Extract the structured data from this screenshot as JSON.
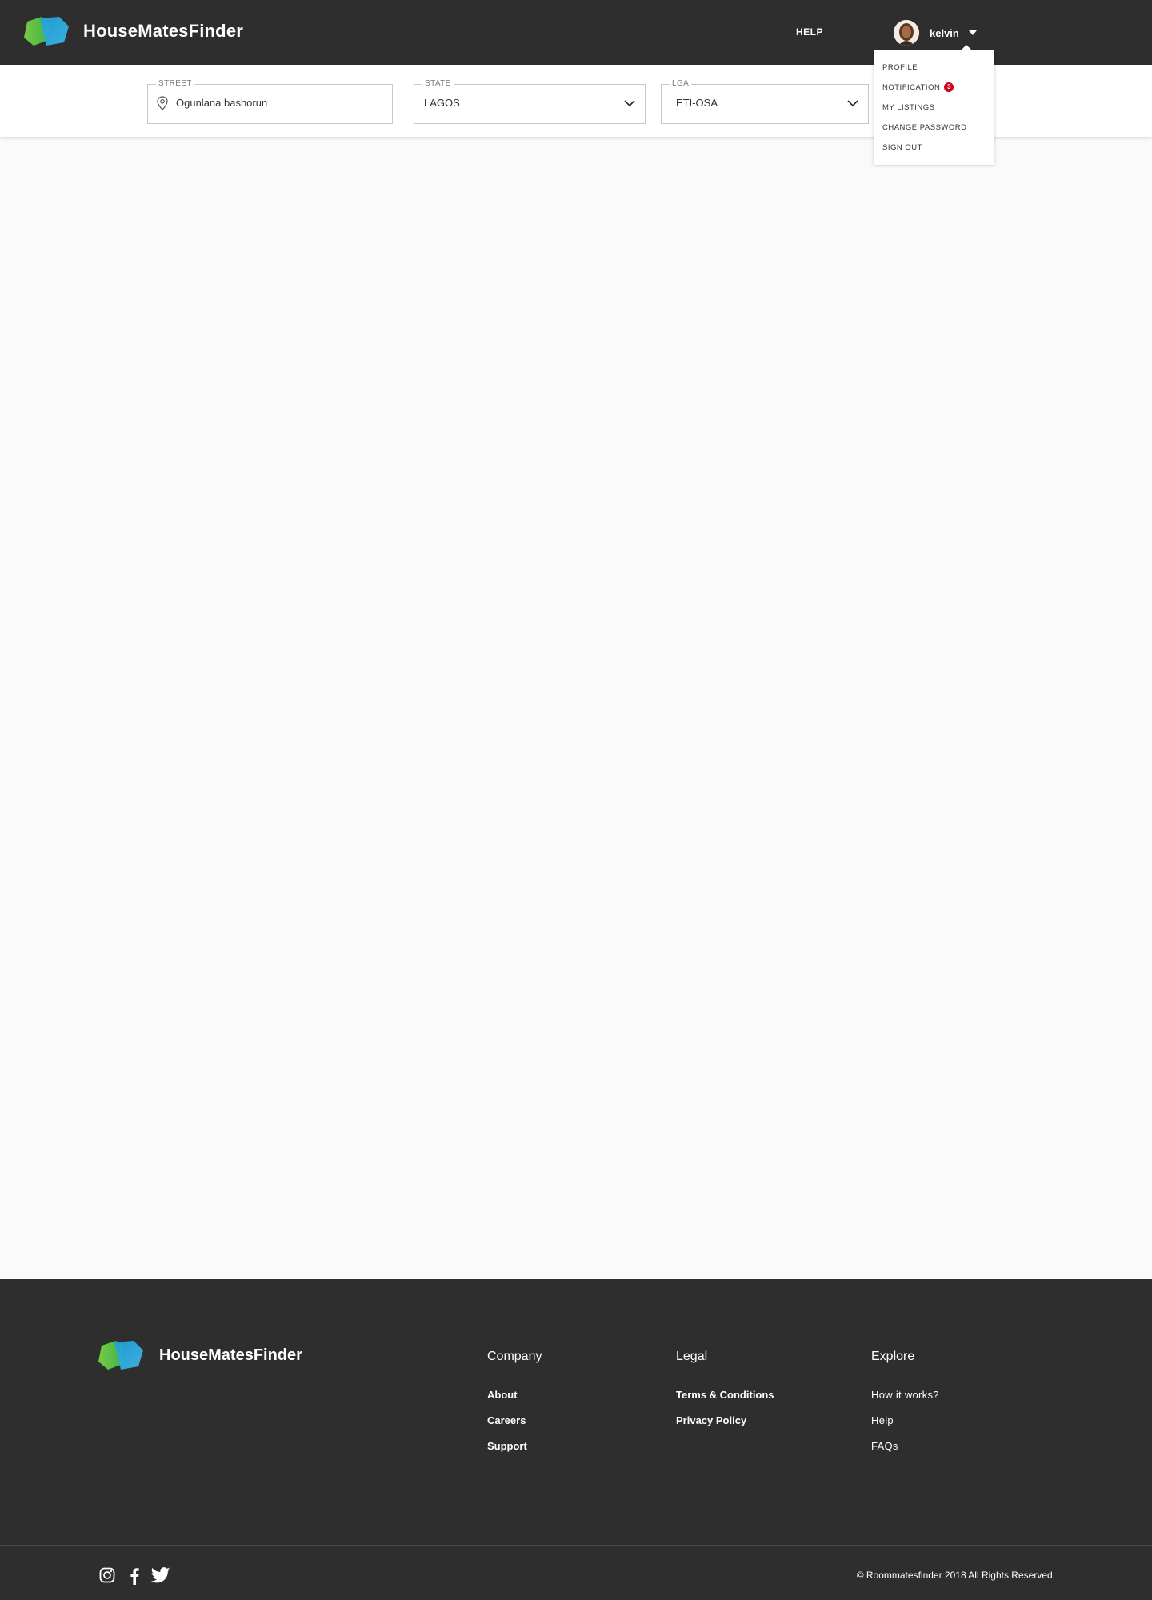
{
  "header": {
    "brand": "HouseMatesFinder",
    "help_label": "HELP",
    "user_name": "kelvin"
  },
  "user_dropdown": {
    "items": [
      {
        "label": "PROFILE"
      },
      {
        "label": "NOTIFICATION",
        "badge": "3"
      },
      {
        "label": "MY LISTINGS"
      },
      {
        "label": "CHANGE PASSWORD"
      },
      {
        "label": "SIGN OUT"
      }
    ]
  },
  "search": {
    "street": {
      "label": "STREET",
      "value": "Ogunlana bashorun"
    },
    "state": {
      "label": "STATE",
      "value": "LAGOS"
    },
    "lga": {
      "label": "LGA",
      "value": "ETI-OSA"
    }
  },
  "footer": {
    "brand": "HouseMatesFinder",
    "columns": [
      {
        "title": "Company",
        "links": [
          "About",
          "Careers",
          "Support"
        ]
      },
      {
        "title": "Legal",
        "links": [
          "Terms & Conditions",
          "Privacy Policy"
        ]
      },
      {
        "title": "Explore",
        "links": [
          "How it works?",
          "Help",
          "FAQs"
        ]
      }
    ],
    "social_icons": [
      "instagram-icon",
      "facebook-icon",
      "twitter-icon"
    ],
    "copyright": "© Roommatesfinder 2018 All Rights Reserved."
  },
  "colors": {
    "header_bg": "#2e2e2e",
    "page_bg": "#fafafa",
    "logo_green": "#5ec43c",
    "logo_blue": "#2aa6e0",
    "badge_red": "#d0021b"
  }
}
